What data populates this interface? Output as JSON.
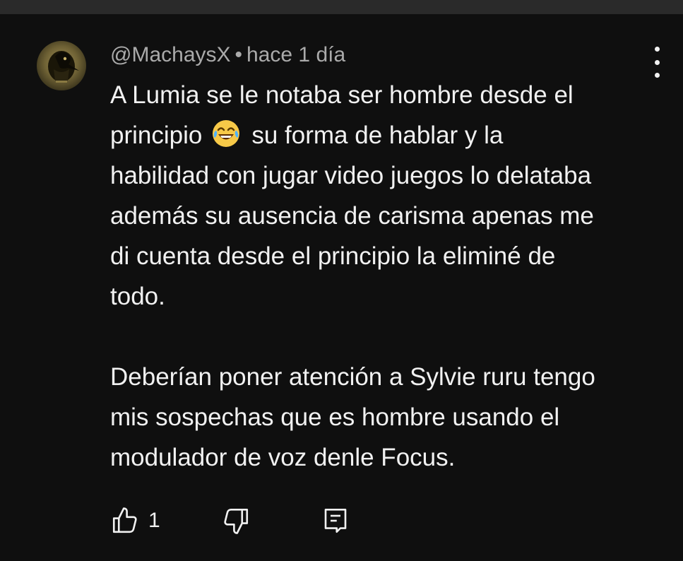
{
  "comment": {
    "author": "@MachaysX",
    "separator": "•",
    "time": "hace 1 día",
    "body_lines": [
      "A Lumia se le notaba ser hombre desde el",
      "principio",
      "😂",
      "su forma de hablar y la",
      "habilidad con jugar video juegos lo delataba",
      "además su ausencia de carisma apenas me",
      "di cuenta desde el principio la eliminé de",
      "todo.",
      "Deberían poner atención a Sylvie ruru tengo",
      "mis sospechas que es hombre usando el",
      "modulador de voz denle Focus."
    ],
    "like_count": "1"
  },
  "icons": {
    "menu": "more-vert-icon",
    "like": "thumbs-up-icon",
    "dislike": "thumbs-down-icon",
    "reply": "reply-comment-icon"
  },
  "colors": {
    "background": "#0f0f0f",
    "text": "#f1f1f1",
    "meta_text": "#aaaaaa",
    "emoji_face": "#f7c948"
  }
}
